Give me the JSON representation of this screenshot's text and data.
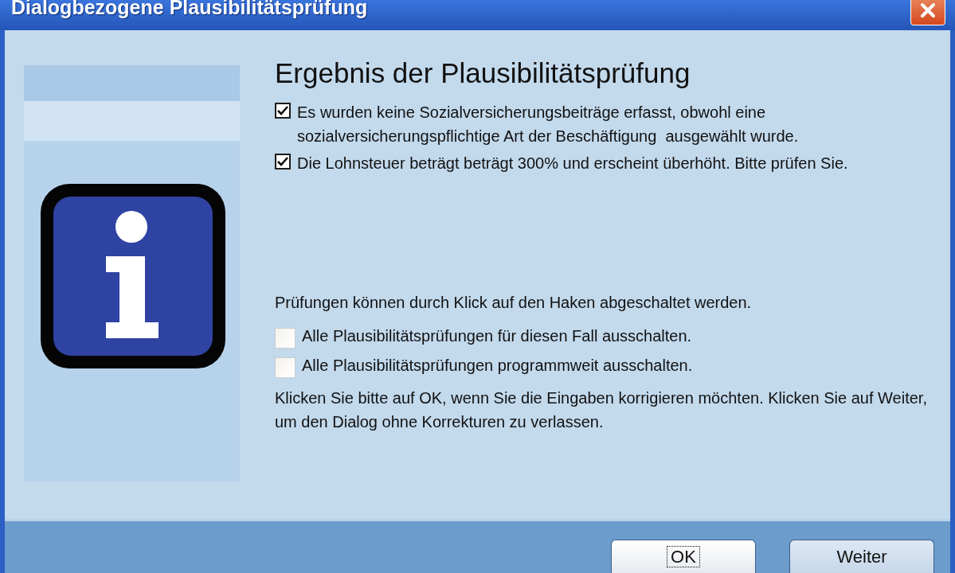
{
  "window": {
    "title": "Dialogbezogene Plausibilitätsprüfung"
  },
  "heading": "Ergebnis der Plausibilitätsprüfung",
  "findings": [
    {
      "label": "Es wurden keine Sozialversicherungsbeiträge erfasst, obwohl eine sozialversicherungspflichtige Art der Beschäftigung  ausgewählt wurde.",
      "checked": true
    },
    {
      "label": "Die Lohnsteuer beträgt beträgt 300% und erscheint überhöht. Bitte prüfen Sie.",
      "checked": true
    }
  ],
  "hint": "Prüfungen können durch Klick auf den Haken abgeschaltet werden.",
  "options": [
    {
      "label": "Alle Plausibilitätsprüfungen für diesen Fall ausschalten.",
      "checked": false
    },
    {
      "label": "Alle Plausibilitätsprüfungen programmweit ausschalten.",
      "checked": false
    }
  ],
  "instructions": "Klicken Sie bitte auf OK, wenn Sie die Eingaben korrigieren möchten. Klicken Sie auf Weiter, um den Dialog ohne Korrekturen zu verlassen.",
  "buttons": [
    {
      "label": "OK",
      "focused": true
    },
    {
      "label": "Weiter",
      "focused": false
    }
  ]
}
